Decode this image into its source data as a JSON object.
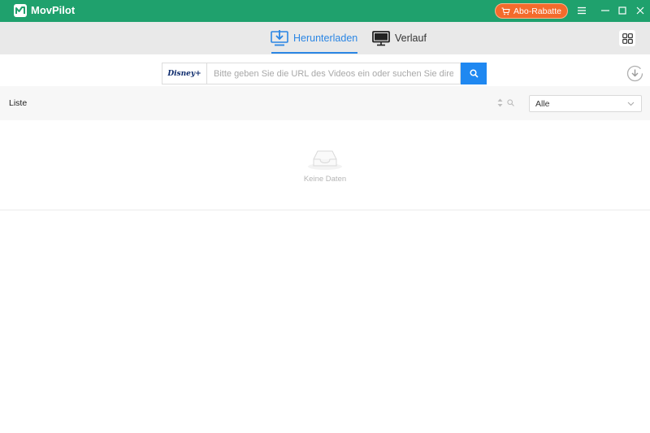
{
  "app": {
    "title": "MovPilot"
  },
  "titlebar": {
    "promo_label": "Abo-Rabatte"
  },
  "nav": {
    "tabs": [
      {
        "label": "Herunterladen",
        "icon": "download-monitor-icon",
        "active": true
      },
      {
        "label": "Verlauf",
        "icon": "monitor-icon",
        "active": false
      }
    ]
  },
  "search": {
    "service": "Disney+",
    "placeholder": "Bitte geben Sie die URL des Videos ein oder suchen Sie direkt."
  },
  "list": {
    "title": "Liste",
    "filter_value": "Alle",
    "empty_text": "Keine Daten"
  },
  "colors": {
    "titlebar": "#1fa16d",
    "accent": "#2b86e4",
    "search_button": "#1f88f1",
    "promo": "#f46b2c"
  }
}
